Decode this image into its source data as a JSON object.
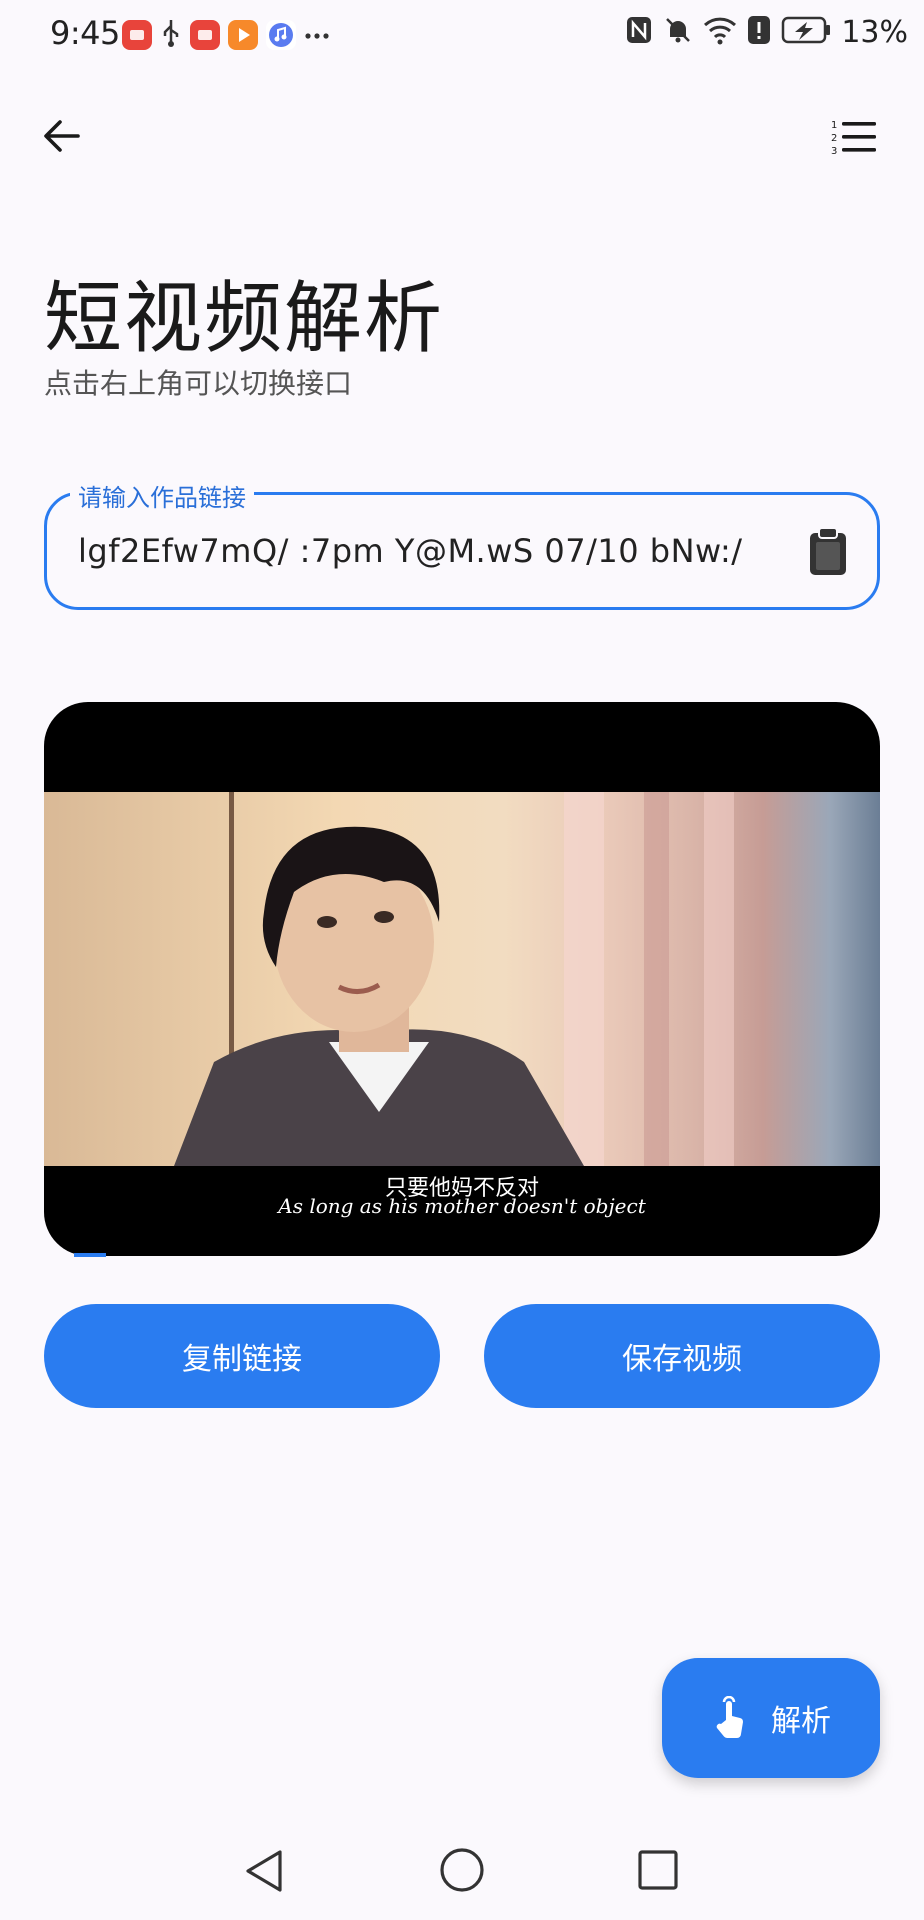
{
  "status_bar": {
    "time": "9:45",
    "battery": "13%",
    "notifications": [
      "huawei-appgallery-icon",
      "usb-icon",
      "huawei-appgallery-icon",
      "video-app-icon",
      "music-icon",
      "more-dots-icon"
    ],
    "right_icons": [
      "nfc-icon",
      "mute-icon",
      "wifi-icon",
      "alert-icon",
      "battery-charging-icon"
    ]
  },
  "toolbar": {
    "back_icon": "arrow-left-icon",
    "menu_icon": "numbered-list-icon"
  },
  "header": {
    "title": "短视频解析",
    "subtitle": "点击右上角可以切换接口"
  },
  "link_input": {
    "label": "请输入作品链接",
    "value": "lgf2Efw7mQ/ :7pm Y@M.wS 07/10 bNw:/",
    "trailing_icon": "clipboard-icon"
  },
  "video": {
    "subtitle_zh": "只要他妈不反对",
    "subtitle_en": "As long as his mother doesn't object",
    "progress": 0.04
  },
  "actions": {
    "copy_label": "复制链接",
    "save_label": "保存视频"
  },
  "fab": {
    "label": "解析",
    "icon": "tap-hand-icon"
  },
  "colors": {
    "accent": "#2a7cf0",
    "background": "#fbf9fd",
    "text": "#1b1b1f"
  }
}
